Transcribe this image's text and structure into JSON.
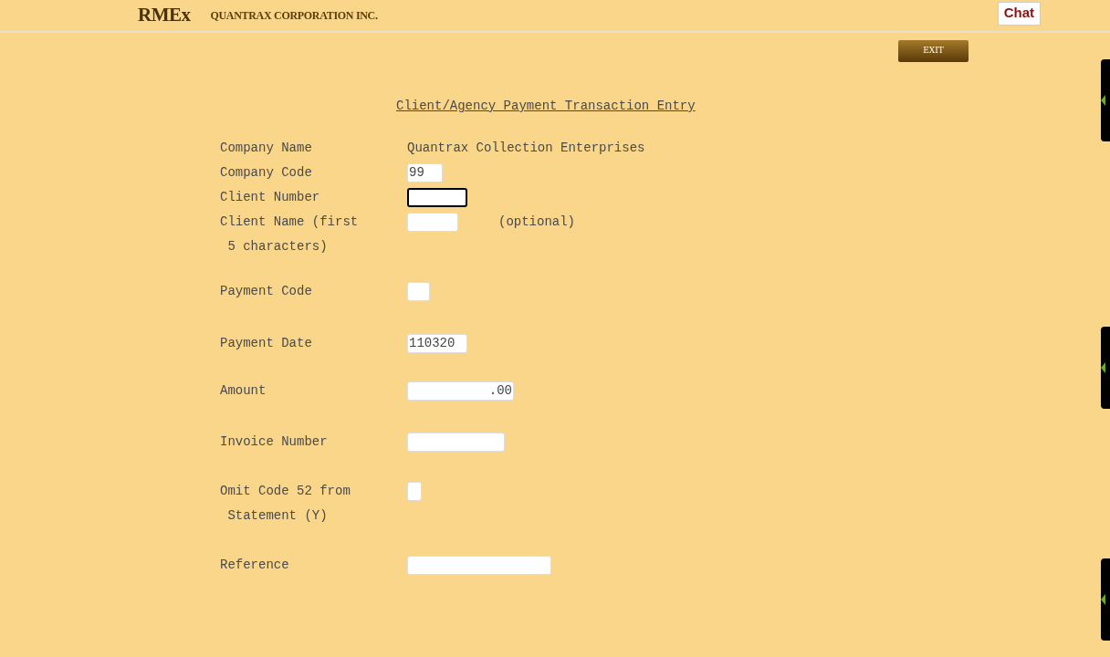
{
  "header": {
    "logo": "RMEx",
    "company": "QUANTRAX CORPORATION INC.",
    "chat_button": "Chat"
  },
  "exit_button": "EXIT",
  "title": "Client/Agency Payment Transaction Entry",
  "rows": [
    {
      "kind": "text",
      "label": [
        "Company Name"
      ],
      "value": "Quantrax Collection Enterprises"
    },
    {
      "kind": "input",
      "label": [
        "Company Code"
      ],
      "value": "99",
      "focused": false
    },
    {
      "kind": "input",
      "label": [
        "Client Number"
      ],
      "value": "",
      "focused": true
    },
    {
      "kind": "input",
      "label": [
        "Client Name (first",
        " 5 characters)"
      ],
      "value": "",
      "focused": false,
      "note": "(optional)"
    },
    {
      "kind": "input",
      "label": [
        "Payment Code"
      ],
      "value": "",
      "focused": false
    },
    {
      "kind": "input",
      "label": [
        "Payment Date"
      ],
      "value": "110320",
      "focused": false
    },
    {
      "kind": "amount",
      "label": [
        "Amount"
      ],
      "value": ".00",
      "focused": false
    },
    {
      "kind": "input",
      "label": [
        "Invoice Number"
      ],
      "value": "",
      "focused": false
    },
    {
      "kind": "input",
      "label": [
        "Omit Code 52 from",
        " Statement (Y)"
      ],
      "value": "",
      "focused": false
    },
    {
      "kind": "input",
      "label": [
        "Reference"
      ],
      "value": "",
      "focused": false
    }
  ]
}
